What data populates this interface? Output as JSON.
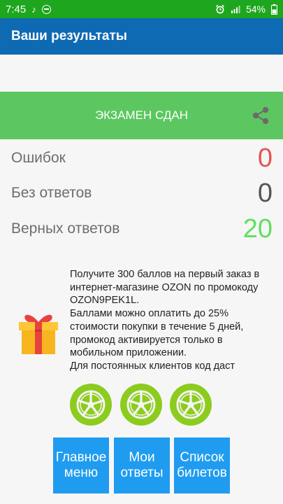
{
  "status_bar": {
    "time": "7:45",
    "battery": "54%",
    "left_icons": [
      "music-note-icon",
      "dnd-icon"
    ],
    "right_icons": [
      "alarm-icon",
      "signal-icon",
      "battery-icon"
    ]
  },
  "app_bar": {
    "title": "Ваши результаты"
  },
  "result": {
    "label": "ЭКЗАМЕН СДАН",
    "share_icon": "share-icon"
  },
  "stats": [
    {
      "label": "Ошибок",
      "value": "0",
      "color": "#e35454"
    },
    {
      "label": "Без ответов",
      "value": "0",
      "color": "#555555"
    },
    {
      "label": "Верных ответов",
      "value": "20",
      "color": "#5ee05e"
    }
  ],
  "promo": {
    "icon": "gift-icon",
    "text": "Получите 300 баллов на первый заказ в интернет-магазине OZON по промокоду OZON9PEK1L.\nБаллами можно оплатить до 25% стоимости покупки в течение 5 дней, промокод активируется только в мобильном приложении.\nДля постоянных клиентов код даст"
  },
  "wheels": [
    "wheel-icon",
    "wheel-icon",
    "wheel-icon"
  ],
  "buttons": {
    "main_menu": "Главное\nменю",
    "my_answers": "Мои\nответы",
    "ticket_list": "Список\nбилетов"
  },
  "colors": {
    "status_bar": "#1ea61e",
    "app_bar": "#0f6ab4",
    "banner": "#5cc760",
    "button": "#1f9cf0",
    "wheel": "#8ccc1e"
  }
}
